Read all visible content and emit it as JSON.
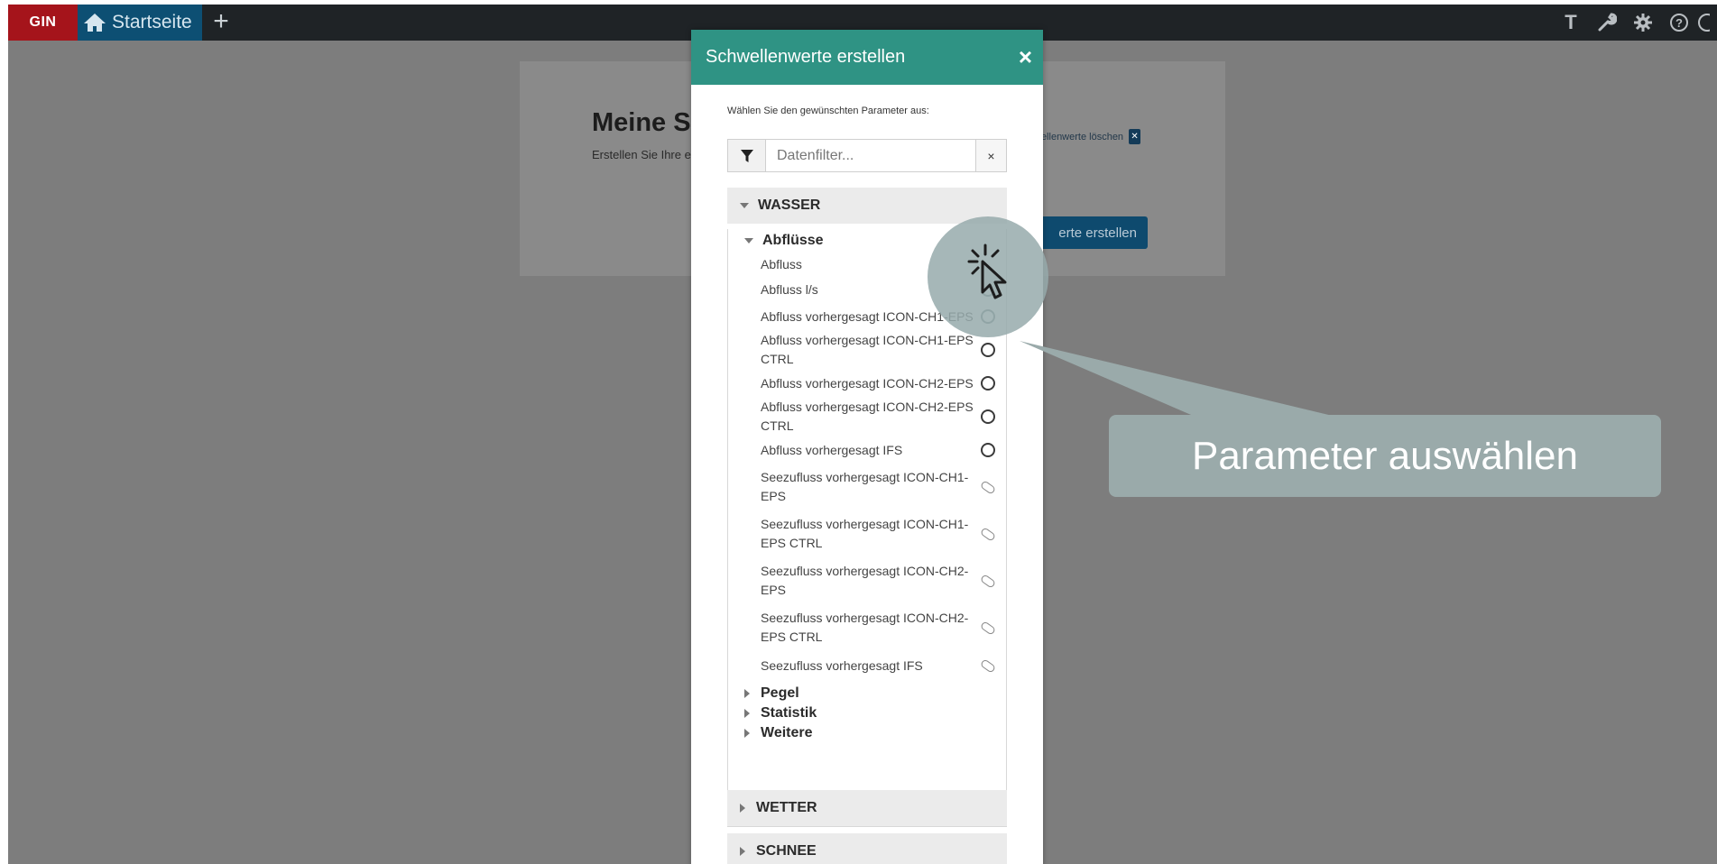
{
  "topbar": {
    "brand": "GIN",
    "home_tab": "Startseite",
    "add_tab": "+",
    "icons": [
      "text-icon",
      "wrench-icon",
      "gear-icon",
      "help-icon",
      "info-icon"
    ],
    "text_icon_glyph": "T"
  },
  "card": {
    "title": "Meine S",
    "subtitle": "Erstellen Sie Ihre e",
    "delete_label": "wellenwerte löschen",
    "create_button": "erte erstellen"
  },
  "modal": {
    "title": "Schwellenwerte erstellen",
    "close": "×",
    "instruction": "Wählen Sie den gewünschten Parameter aus:",
    "filter": {
      "placeholder": "Datenfilter...",
      "clear": "×"
    },
    "groups": {
      "wasser": {
        "label": "WASSER",
        "subgroup": {
          "label": "Abflüsse",
          "items": [
            {
              "label": "Abfluss",
              "kind": "radio"
            },
            {
              "label": "Abfluss l/s",
              "kind": "radio"
            },
            {
              "label": "Abfluss vorhergesagt ICON-CH1-EPS",
              "kind": "radio"
            },
            {
              "label": "Abfluss vorhergesagt ICON-CH1-EPS CTRL",
              "kind": "radio"
            },
            {
              "label": "Abfluss vorhergesagt ICON-CH2-EPS",
              "kind": "radio"
            },
            {
              "label": "Abfluss vorhergesagt ICON-CH2-EPS CTRL",
              "kind": "radio"
            },
            {
              "label": "Abfluss vorhergesagt IFS",
              "kind": "radio"
            },
            {
              "label": "Seezufluss vorhergesagt ICON-CH1-EPS",
              "kind": "pill"
            },
            {
              "label": "Seezufluss vorhergesagt ICON-CH1-EPS CTRL",
              "kind": "pill"
            },
            {
              "label": "Seezufluss vorhergesagt ICON-CH2-EPS",
              "kind": "pill"
            },
            {
              "label": "Seezufluss vorhergesagt ICON-CH2-EPS CTRL",
              "kind": "pill"
            },
            {
              "label": "Seezufluss vorhergesagt IFS",
              "kind": "pill"
            }
          ]
        },
        "collapsed_subgroups": [
          "Pegel",
          "Statistik",
          "Weitere"
        ]
      },
      "wetter": {
        "label": "WETTER"
      },
      "schnee": {
        "label": "SCHNEE"
      }
    }
  },
  "callout": {
    "text": "Parameter auswählen"
  },
  "colors": {
    "brand_red": "#a5141b",
    "header_teal": "#2f9384",
    "home_tab_blue": "#0d4f73",
    "callout": "#9aaaaa"
  }
}
